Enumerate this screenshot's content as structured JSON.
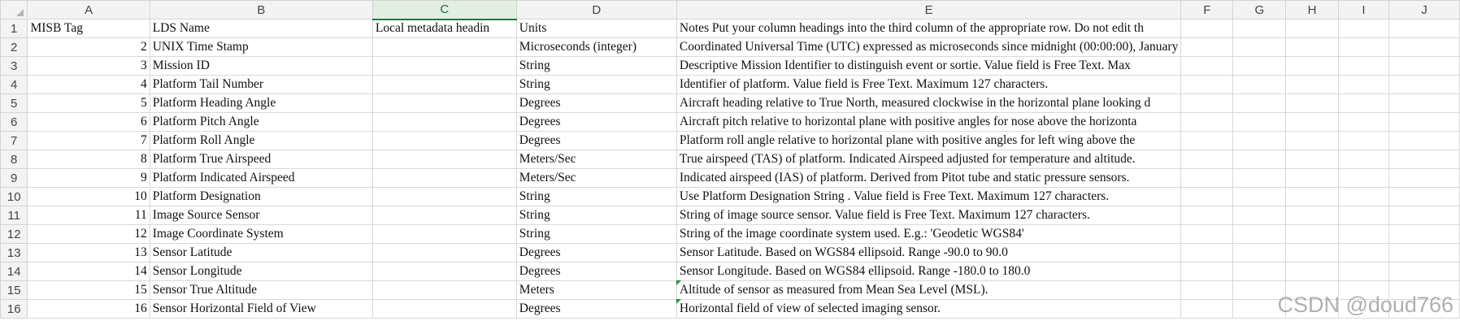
{
  "columns": [
    "A",
    "B",
    "C",
    "D",
    "E",
    "F",
    "G",
    "H",
    "I",
    "J"
  ],
  "selected_column": "C",
  "rows": [
    {
      "n": "1",
      "a": "MISB Tag",
      "b": "LDS Name",
      "c": "Local metadata headin",
      "d": "Units",
      "e": "Notes  Put your column headings into the third column of the appropriate row.  Do not edit th"
    },
    {
      "n": "2",
      "a": "2",
      "b": "UNIX Time Stamp",
      "c": "",
      "d": "Microseconds (integer)",
      "e": "Coordinated Universal Time (UTC) expressed as microseconds since midnight (00:00:00), January"
    },
    {
      "n": "3",
      "a": "3",
      "b": "Mission ID",
      "c": "",
      "d": "String",
      "e": "Descriptive Mission Identifier to distinguish event or sortie. Value field is Free Text. Max"
    },
    {
      "n": "4",
      "a": "4",
      "b": "Platform Tail Number",
      "c": "",
      "d": "String",
      "e": "Identifier of platform. Value field is Free Text. Maximum 127 characters."
    },
    {
      "n": "5",
      "a": "5",
      "b": "Platform Heading Angle",
      "c": "",
      "d": "Degrees",
      "e": "Aircraft heading relative to True North, measured clockwise in the horizontal plane looking d"
    },
    {
      "n": "6",
      "a": "6",
      "b": "Platform Pitch Angle",
      "c": "",
      "d": "Degrees",
      "e": "Aircraft pitch relative to horizontal plane with positive angles for nose above the horizonta"
    },
    {
      "n": "7",
      "a": "7",
      "b": "Platform Roll Angle",
      "c": "",
      "d": "Degrees",
      "e": "Platform roll angle relative to horizontal plane with positive angles for left wing above the"
    },
    {
      "n": "8",
      "a": "8",
      "b": "Platform True Airspeed",
      "c": "",
      "d": "Meters/Sec",
      "e": "True airspeed (TAS) of platform. Indicated Airspeed adjusted for temperature and altitude."
    },
    {
      "n": "9",
      "a": "9",
      "b": "Platform Indicated Airspeed",
      "c": "",
      "d": "Meters/Sec",
      "e": "Indicated airspeed (IAS) of platform. Derived from Pitot tube and static pressure sensors."
    },
    {
      "n": "10",
      "a": "10",
      "b": "Platform Designation",
      "c": "",
      "d": "String",
      "e": "Use Platform Designation String . Value field is Free Text. Maximum 127 characters."
    },
    {
      "n": "11",
      "a": "11",
      "b": "Image Source Sensor",
      "c": "",
      "d": "String",
      "e": "String of image source sensor. Value field is Free Text. Maximum 127 characters."
    },
    {
      "n": "12",
      "a": "12",
      "b": "Image Coordinate System",
      "c": "",
      "d": "String",
      "e": "String of the image coordinate system used. E.g.: 'Geodetic WGS84'"
    },
    {
      "n": "13",
      "a": "13",
      "b": "Sensor Latitude",
      "c": "",
      "d": "Degrees",
      "e": "Sensor Latitude. Based on WGS84 ellipsoid.  Range -90.0 to 90.0"
    },
    {
      "n": "14",
      "a": "14",
      "b": "Sensor Longitude",
      "c": "",
      "d": "Degrees",
      "e": "Sensor Longitude. Based on WGS84 ellipsoid.  Range -180.0 to 180.0"
    },
    {
      "n": "15",
      "a": "15",
      "b": "Sensor True Altitude",
      "c": "",
      "d": "Meters",
      "e": "Altitude of sensor as measured from Mean Sea Level (MSL)."
    },
    {
      "n": "16",
      "a": "16",
      "b": "Sensor Horizontal Field of View",
      "c": "",
      "d": "Degrees",
      "e": "Horizontal field of view of selected imaging sensor."
    }
  ],
  "watermark": "CSDN @doud766"
}
